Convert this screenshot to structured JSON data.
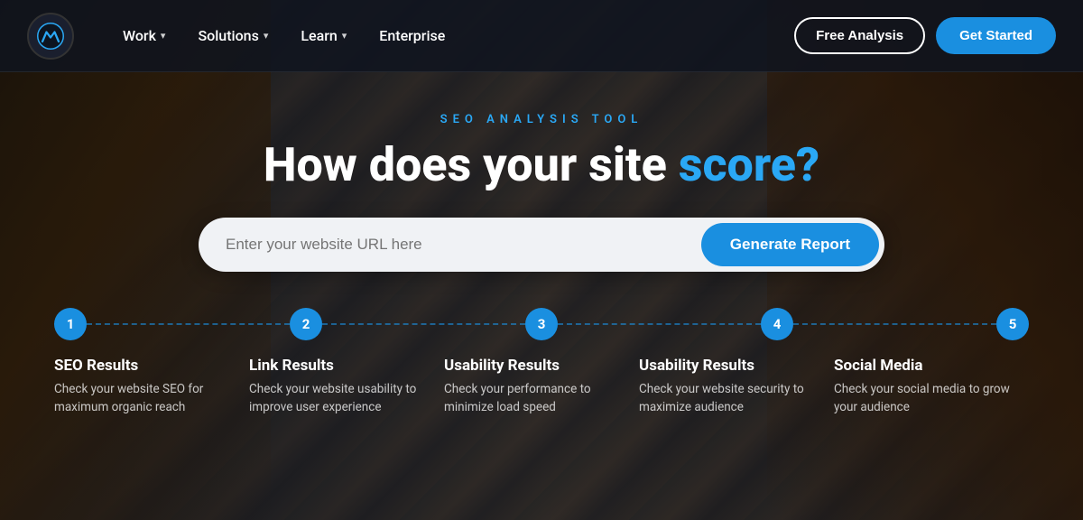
{
  "brand": {
    "logo_alt": "Moz Logo"
  },
  "navbar": {
    "links": [
      {
        "label": "Work",
        "has_dropdown": true
      },
      {
        "label": "Solutions",
        "has_dropdown": true
      },
      {
        "label": "Learn",
        "has_dropdown": true
      },
      {
        "label": "Enterprise",
        "has_dropdown": false
      }
    ],
    "free_analysis_label": "Free Analysis",
    "get_started_label": "Get Started"
  },
  "hero": {
    "subtitle": "SEO ANALYSIS TOOL",
    "title_part1": "How does your site ",
    "title_accent": "score?",
    "search_placeholder": "Enter your website URL here",
    "generate_button_label": "Generate Report"
  },
  "steps": [
    {
      "number": "1",
      "title": "SEO Results",
      "description": "Check your website SEO for maximum organic reach"
    },
    {
      "number": "2",
      "title": "Link Results",
      "description": "Check your website usability to improve user experience"
    },
    {
      "number": "3",
      "title": "Usability Results",
      "description": "Check your performance to minimize load speed"
    },
    {
      "number": "4",
      "title": "Usability Results",
      "description": "Check your website security to maximize audience"
    },
    {
      "number": "5",
      "title": "Social Media",
      "description": "Check your social media to grow your audience"
    }
  ],
  "colors": {
    "accent": "#1a8fe0",
    "accent_light": "#2aa8f5"
  }
}
